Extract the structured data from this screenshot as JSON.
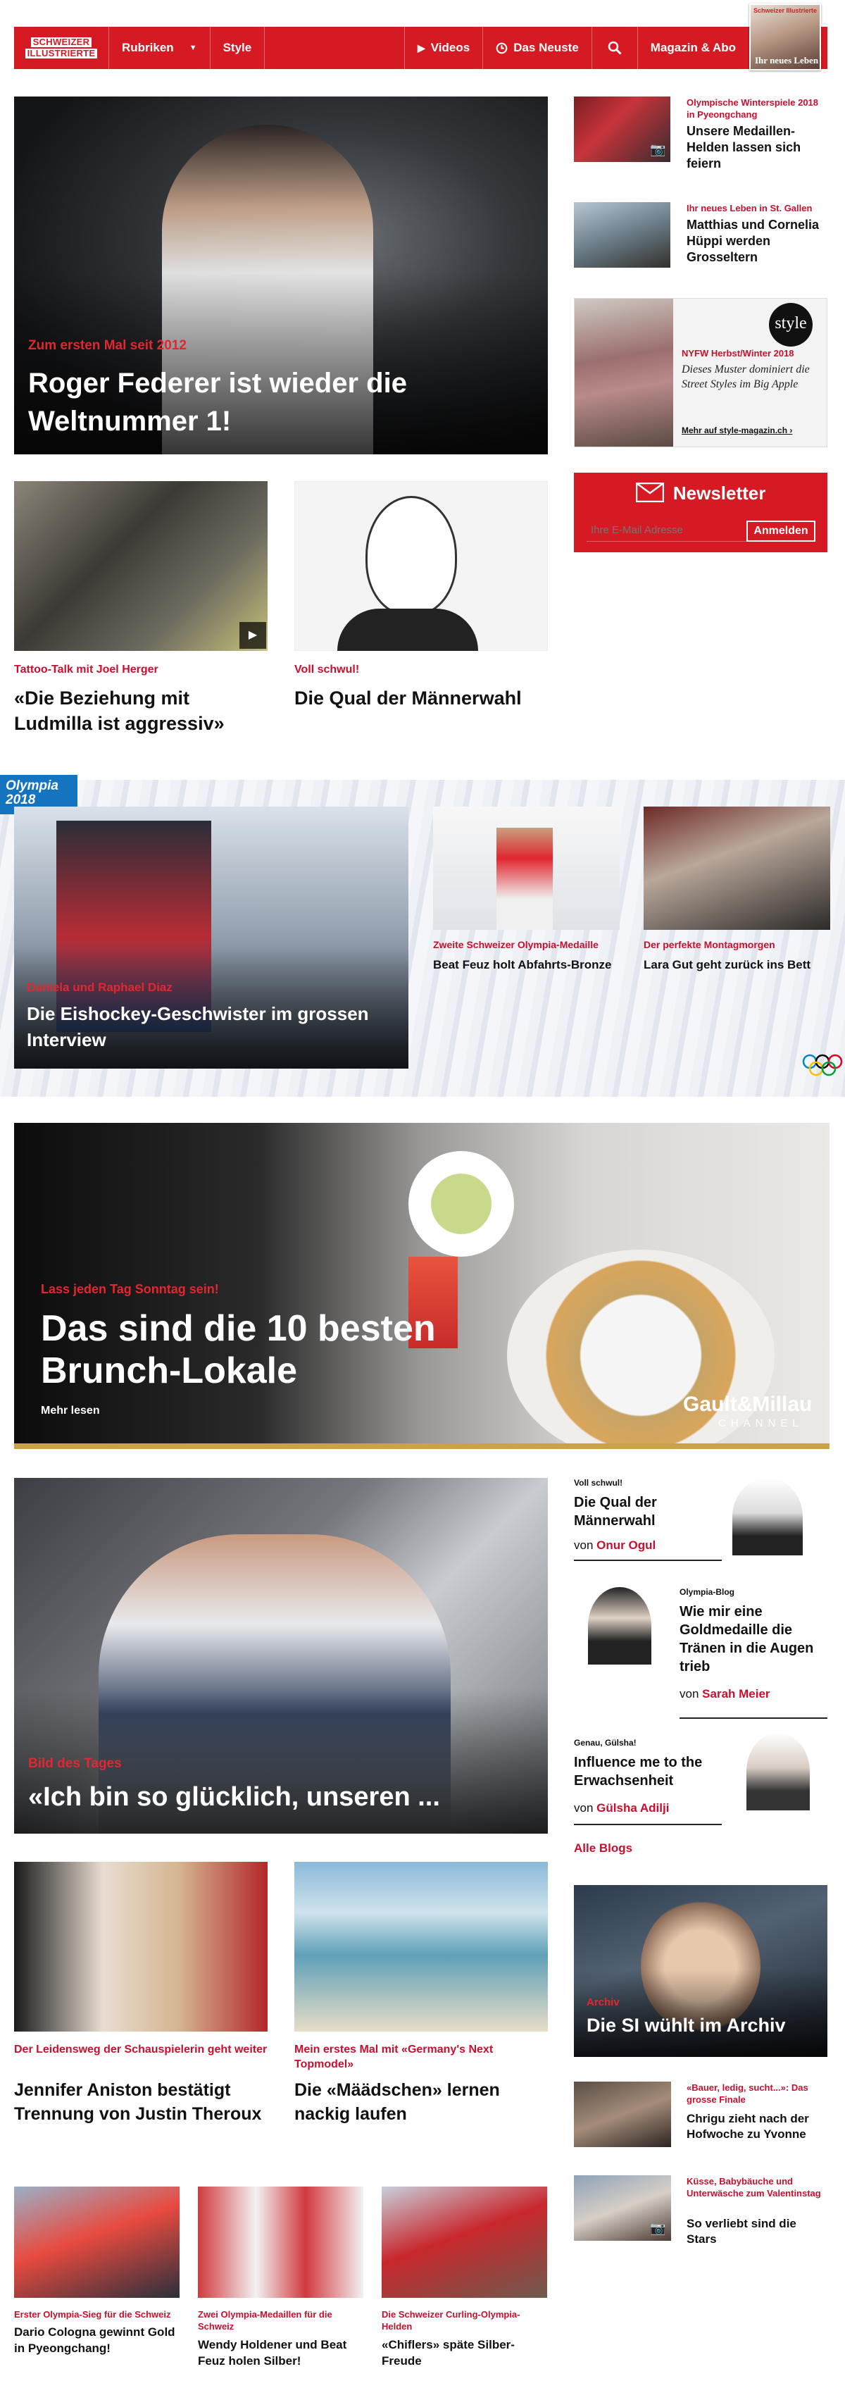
{
  "nav": {
    "logo_line1": "SCHWEIZER",
    "logo_line2": "ILLUSTRIERTE",
    "rubriken": "Rubriken",
    "style": "Style",
    "videos": "Videos",
    "neuste": "Das Neuste",
    "abo": "Magazin & Abo",
    "cover_title": "Schweizer Illustrierte",
    "cover_headline": "Ihr neues Leben"
  },
  "hero": {
    "kicker": "Zum ersten Mal seit 2012",
    "title": "Roger Federer ist wieder die Weltnummer 1!"
  },
  "side_top": [
    {
      "kicker": "Olympische Winterspiele 2018 in Pyeongchang",
      "title": "Unsere Medaillen-Helden lassen sich feiern"
    },
    {
      "kicker": "Ihr neues Leben in St. Gallen",
      "title": "Matthias und Cornelia Hüppi werden Grosseltern"
    }
  ],
  "style_ad": {
    "logo": "style",
    "kicker": "NYFW Herbst/Winter 2018",
    "title": "Dieses Muster dominiert die Street Styles im Big Apple",
    "link": "Mehr auf style-magazin.ch ›"
  },
  "newsletter": {
    "title": "Newsletter",
    "placeholder": "Ihre E-Mail Adresse",
    "button": "Anmelden"
  },
  "row2": [
    {
      "kicker": "Tattoo-Talk mit Joel Herger",
      "title": "«Die Beziehung mit Ludmilla ist aggressiv»"
    },
    {
      "kicker": "Voll schwul!",
      "title": "Die Qual der Männerwahl"
    }
  ],
  "olympia": {
    "badge": "Olympia 2018",
    "main_kicker": "Daniela und Raphael Diaz",
    "main_title": "Die Eishockey-Geschwister im grossen Interview",
    "cards": [
      {
        "kicker": "Zweite Schweizer Olympia-Medaille",
        "title": "Beat Feuz holt Abfahrts-Bronze"
      },
      {
        "kicker": "Der perfekte Montagmorgen",
        "title": "Lara Gut geht zurück ins Bett"
      }
    ]
  },
  "brunch": {
    "kicker": "Lass jeden Tag Sonntag sein!",
    "title": "Das sind die 10 besten Brunch-Lokale",
    "more": "Mehr lesen",
    "brand": "Gault&Millau",
    "brand_sub": "CHANNEL"
  },
  "bild": {
    "kicker": "Bild des Tages",
    "title": "«Ich bin so glücklich, unseren ..."
  },
  "blogs": [
    {
      "kicker": "Voll schwul!",
      "title": "Die Qual der Männerwahl",
      "by": "von",
      "author": "Onur Ogul"
    },
    {
      "kicker": "Olympia-Blog",
      "title": "Wie mir eine Goldmedaille die Tränen in die Augen trieb",
      "by": "von",
      "author": "Sarah Meier"
    },
    {
      "kicker": "Genau, Gülsha!",
      "title": "Influence me to the Erwachsenheit",
      "by": "von",
      "author": "Gülsha Adilji"
    }
  ],
  "all_blogs": "Alle Blogs",
  "archiv": {
    "kicker": "Archiv",
    "title": "Die SI wühlt im Archiv"
  },
  "row4": [
    {
      "kicker": "Der Leidensweg der Schauspielerin geht weiter",
      "title": "Jennifer Aniston bestätigt Trennung von Justin Theroux"
    },
    {
      "kicker": "Mein erstes Mal mit «Germany's Next Topmodel»",
      "title": "Die «Määdschen» lernen nackig laufen"
    }
  ],
  "side_small": [
    {
      "kicker": "«Bauer, ledig, sucht...»: Das grosse Finale",
      "title": "Chrigu zieht nach der Hofwoche zu Yvonne"
    },
    {
      "kicker": "Küsse, Babybäuche und Unterwäsche zum Valentinstag",
      "title": "So verliebt sind die Stars"
    }
  ],
  "row5": [
    {
      "kicker": "Erster Olympia-Sieg für die Schweiz",
      "title": "Dario Cologna gewinnt Gold in Pyeongchang!"
    },
    {
      "kicker": "Zwei Olympia-Medaillen für die Schweiz",
      "title": "Wendy Holdener und Beat Feuz holen Silber!"
    },
    {
      "kicker": "Die Schweizer Curling-Olympia-Helden",
      "title": "«Chiflers» späte Silber-Freude"
    }
  ],
  "colors": {
    "brand_red": "#d51a23",
    "kicker_red": "#c8102e",
    "olympia_blue": "#1574c0"
  }
}
